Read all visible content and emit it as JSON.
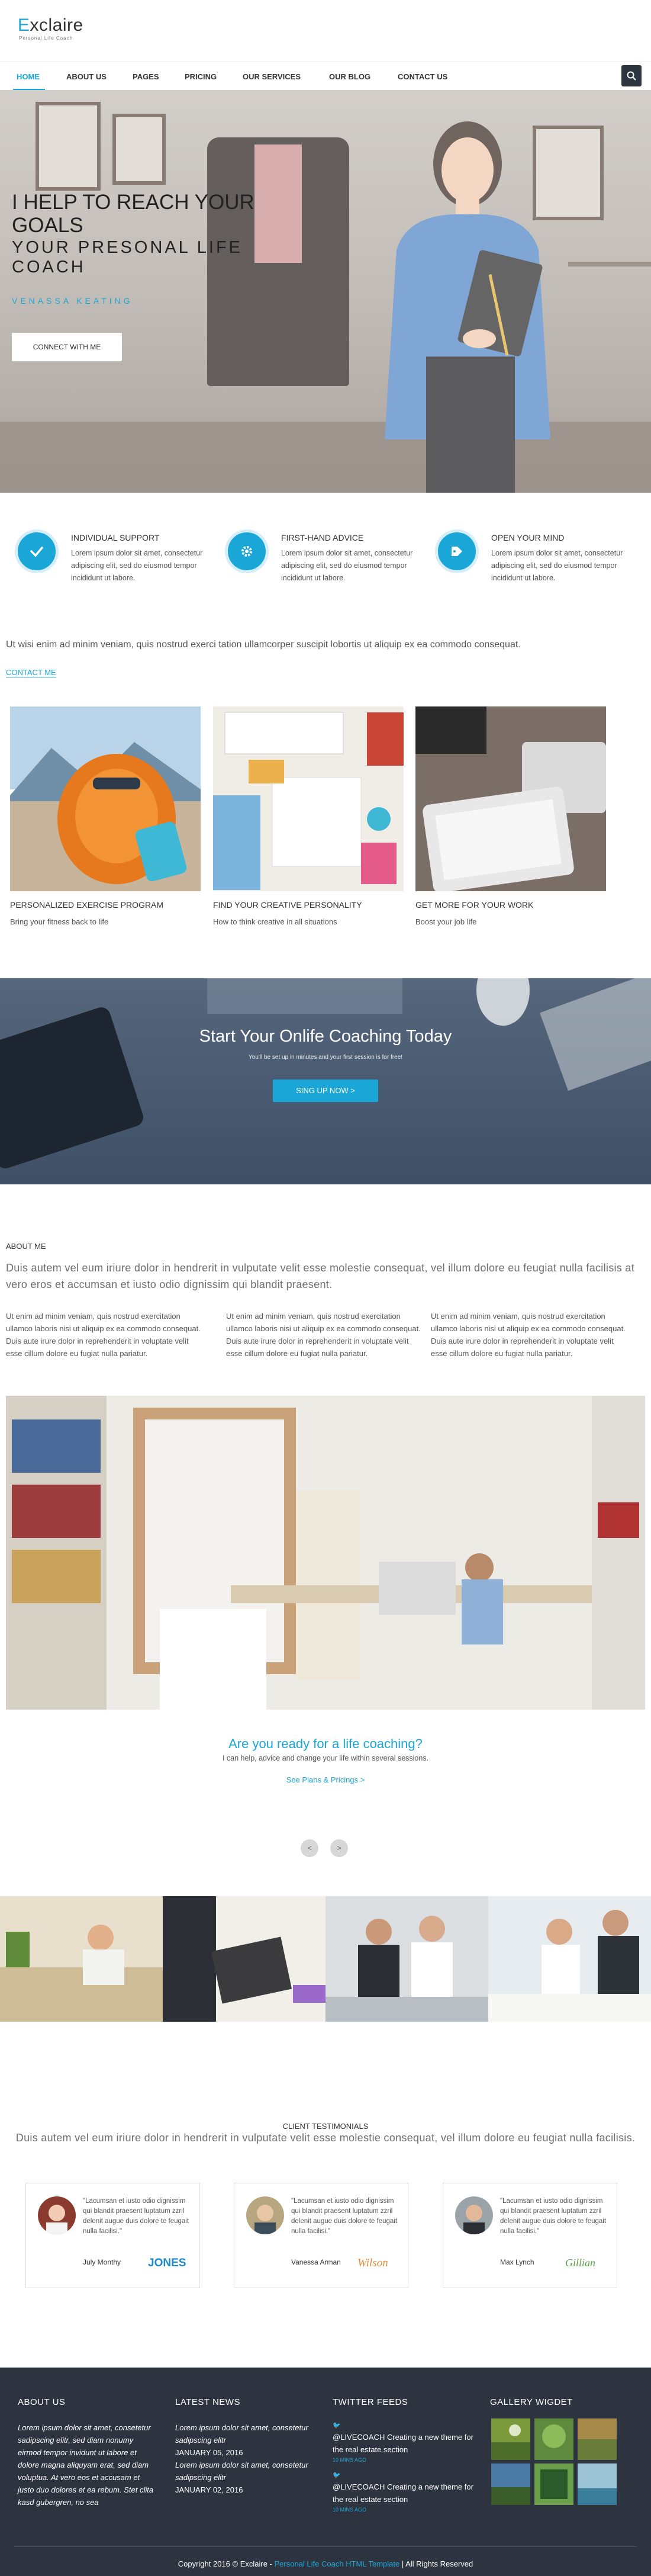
{
  "brand": {
    "logo_first": "E",
    "logo_rest": "xclaire",
    "tagline": "Personal Life Coach",
    "accent": "#1aa6d6",
    "dark": "#2d3440"
  },
  "nav": {
    "items": [
      "HOME",
      "ABOUT US",
      "PAGES",
      "PRICING",
      "OUR SERVICES",
      "OUR BLOG",
      "CONTACT US"
    ],
    "active": "HOME",
    "search_icon": "search-icon"
  },
  "hero": {
    "title": "I HELP TO REACH YOUR GOALS",
    "subtitle": "YOUR PRESONAL LIFE COACH",
    "name": "VENASSA KEATING",
    "button": "CONNECT WITH ME"
  },
  "features": [
    {
      "icon": "check-icon",
      "title": "INDIVIDUAL SUPPORT",
      "text": "Lorem ipsum dolor sit amet, consectetur adipiscing elit, sed do eiusmod tempor incididunt ut labore."
    },
    {
      "icon": "gear-icon",
      "title": "FIRST-HAND ADVICE",
      "text": "Lorem ipsum dolor sit amet, consectetur adipiscing elit, sed do eiusmod tempor incididunt ut labore."
    },
    {
      "icon": "tag-icon",
      "title": "OPEN YOUR MIND",
      "text": "Lorem ipsum dolor sit amet, consectetur adipiscing elit, sed do eiusmod tempor incididunt ut labore."
    }
  ],
  "intro": {
    "text": "Ut wisi enim ad minim veniam, quis nostrud exerci tation ullamcorper suscipit lobortis ut aliquip ex ea commodo consequat.",
    "link": "CONTACT ME"
  },
  "cards": [
    {
      "title": "PERSONALIZED EXERCISE PROGRAM",
      "subtitle": "Bring your fitness back to life"
    },
    {
      "title": "FIND YOUR CREATIVE PERSONALITY",
      "subtitle": "How to think creative in all situations"
    },
    {
      "title": "GET MORE FOR YOUR WORK",
      "subtitle": "Boost your job life"
    }
  ],
  "cta": {
    "title": "Start Your Onlife Coaching Today",
    "subtitle": "You'll be set up in minutes and your first session is for free!",
    "button": "SING UP NOW >"
  },
  "about": {
    "label": "ABOUT ME",
    "lead": "Duis autem vel eum iriure dolor in hendrerit in vulputate velit esse molestie consequat, vel illum dolore eu feugiat nulla facilisis at vero eros et accumsan et iusto odio dignissim qui blandit praesent.",
    "columns": [
      "Ut enim ad minim veniam, quis nostrud exercitation ullamco laboris nisi ut aliquip ex ea commodo consequat. Duis aute irure dolor in reprehenderit in voluptate velit esse cillum dolore eu fugiat nulla pariatur.",
      "Ut enim ad minim veniam, quis nostrud exercitation ullamco laboris nisi ut aliquip ex ea commodo consequat. Duis aute irure dolor in reprehenderit in voluptate velit esse cillum dolore eu fugiat nulla pariatur.",
      "Ut enim ad minim veniam, quis nostrud exercitation ullamco laboris nisi ut aliquip ex ea commodo consequat. Duis aute irure dolor in reprehenderit in voluptate velit esse cillum dolore eu fugiat nulla pariatur."
    ]
  },
  "ready": {
    "title": "Are you ready for a life coaching?",
    "subtitle": "I can help, advice and change your life within several sessions.",
    "link": "See Plans & Pricings >",
    "prev": "<",
    "next": ">"
  },
  "testimonials": {
    "label": "CLIENT TESTIMONIALS",
    "lead": "Duis autem vel eum iriure dolor in hendrerit in vulputate velit esse molestie consequat, vel illum dolore eu feugiat nulla facilisis.",
    "items": [
      {
        "quote": "\"Lacumsan et iusto odio dignissim qui blandit praesent luptatum zzril delenit augue duis dolore te feugait nulla facilisi.\"",
        "name": "July Monthy",
        "logo": "JONES"
      },
      {
        "quote": "\"Lacumsan et iusto odio dignissim qui blandit praesent luptatum zzril delenit augue duis dolore te feugait nulla facilisi.\"",
        "name": "Vanessa Arman",
        "logo": "Wilson"
      },
      {
        "quote": "\"Lacumsan et iusto odio dignissim qui blandit praesent luptatum zzril delenit augue duis dolore te feugait nulla facilisi.\"",
        "name": "Max Lynch",
        "logo": "Gillian"
      }
    ]
  },
  "footer": {
    "about_head": "ABOUT US",
    "about_text": "Lorem ipsum dolor sit amet, consetetur sadipscing elitr, sed diam nonumy eirmod tempor invidunt ut labore et dolore magna aliquyam erat, sed diam voluptua. At vero eos et accusam et justo duo dolores et ea rebum. Stet clita kasd gubergren, no sea",
    "news_head": "LATEST NEWS",
    "news": [
      {
        "text": "Lorem ipsum dolor sit amet, consetetur sadipscing elitr",
        "date": "JANUARY 05, 2016"
      },
      {
        "text": "Lorem ipsum dolor sit amet, consetetur sadipscing elitr",
        "date": "JANUARY 02, 2016"
      }
    ],
    "twitter_head": "TWITTER FEEDS",
    "tweets": [
      {
        "handle": "@LIVECOACH",
        "text": " Creating a new theme for the real estate section",
        "time": "10 MINS AGO"
      },
      {
        "handle": "@LIVECOACH",
        "text": " Creating a new theme for the real estate section",
        "time": "10 MINS AGO"
      }
    ],
    "gallery_head": "GALLERY WIGDET",
    "copyright_pre": "Copyright 2016 © Exclaire - ",
    "copyright_link": "Personal Life Coach HTML Template",
    "copyright_post": " | All Rights Reserved"
  }
}
